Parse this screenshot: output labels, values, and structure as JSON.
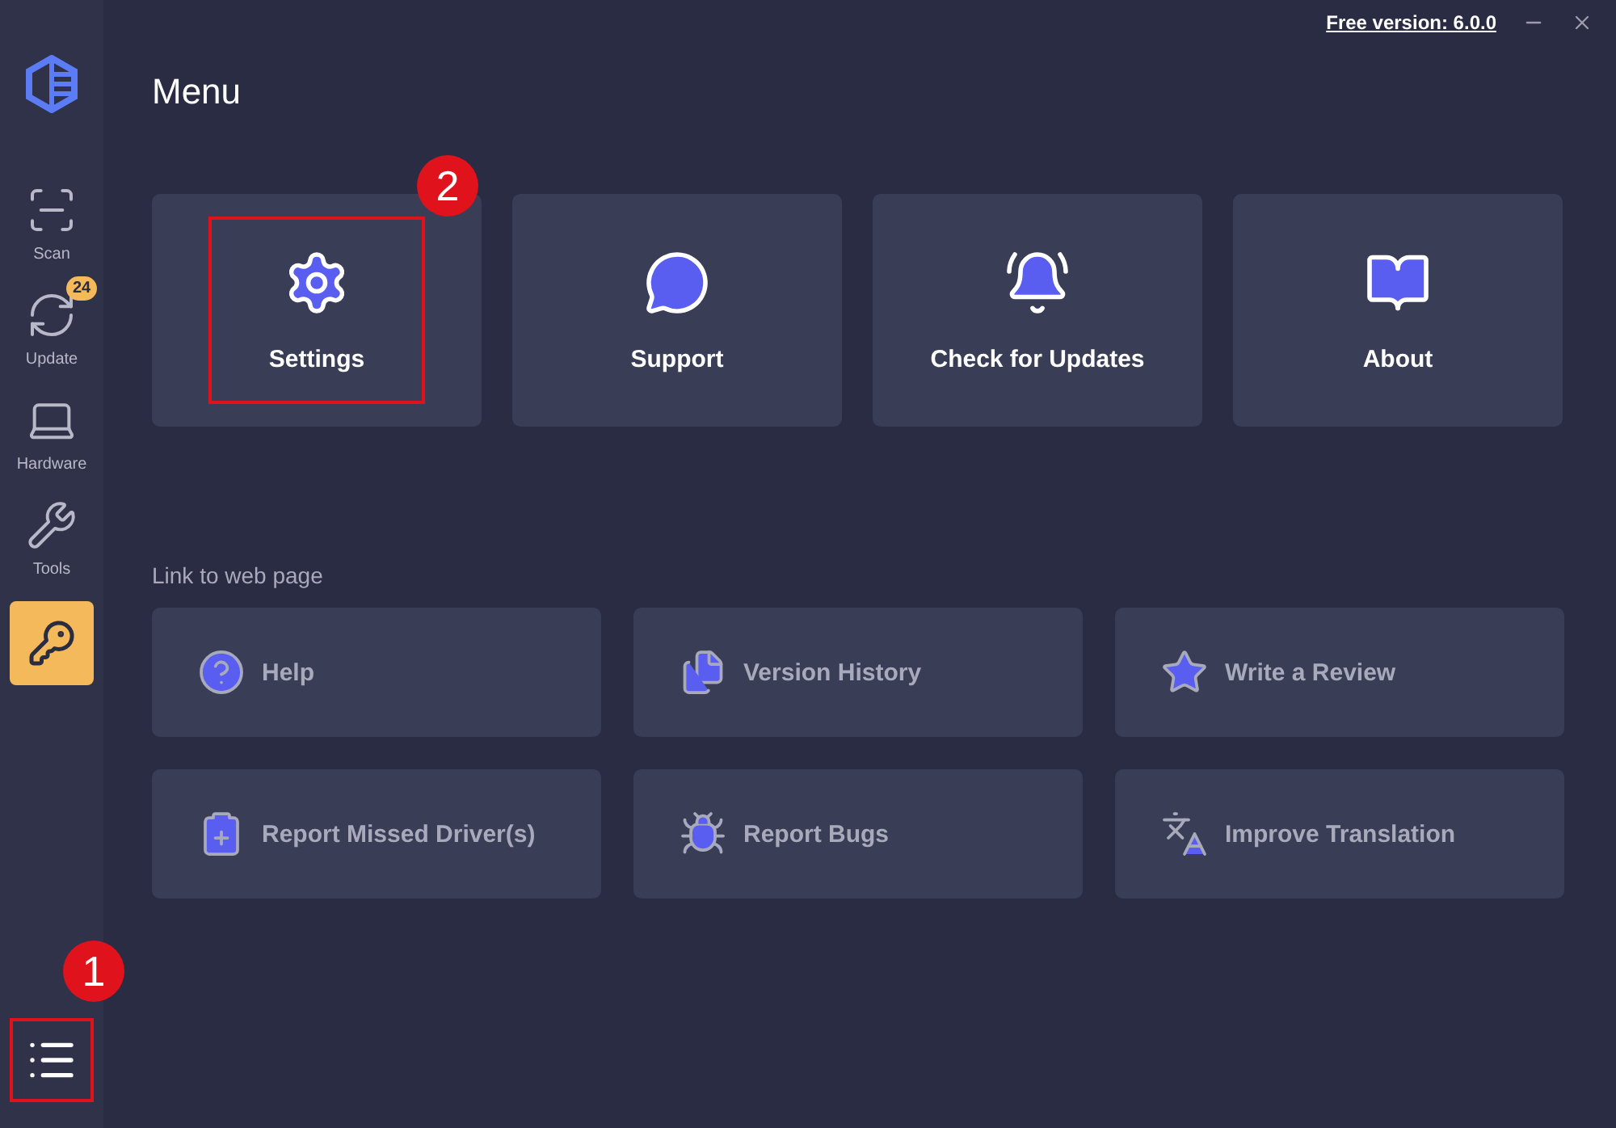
{
  "title_bar": {
    "version_link": "Free version: 6.0.0"
  },
  "sidebar": {
    "items": [
      {
        "kind": "nav",
        "label": "Scan"
      },
      {
        "kind": "nav",
        "label": "Update",
        "badge": "24"
      },
      {
        "kind": "nav",
        "label": "Hardware"
      },
      {
        "kind": "nav",
        "label": "Tools"
      },
      {
        "kind": "key"
      }
    ],
    "menu_button": {
      "callout": "1"
    }
  },
  "page_title": "Menu",
  "cards": [
    {
      "label": "Settings",
      "callout": "2"
    },
    {
      "label": "Support"
    },
    {
      "label": "Check for Updates"
    },
    {
      "label": "About"
    }
  ],
  "links_heading": "Link to web page",
  "links": [
    {
      "label": "Help"
    },
    {
      "label": "Version History"
    },
    {
      "label": "Write a Review"
    },
    {
      "label": "Report Missed Driver(s)"
    },
    {
      "label": "Report Bugs"
    },
    {
      "label": "Improve Translation"
    }
  ]
}
